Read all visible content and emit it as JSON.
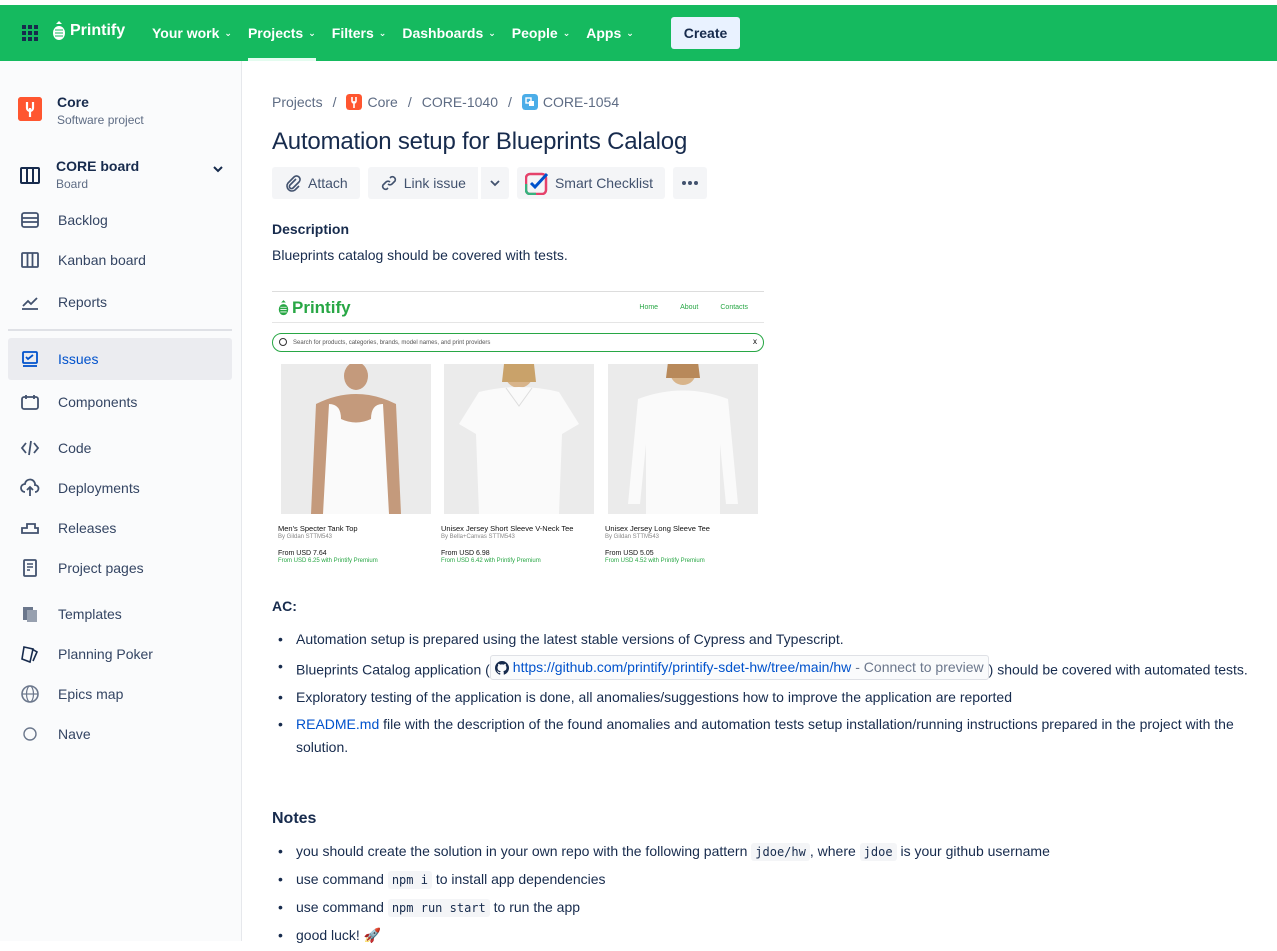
{
  "topbar": {
    "brand": "Printify",
    "nav": [
      {
        "label": "Your work",
        "active": false
      },
      {
        "label": "Projects",
        "active": true
      },
      {
        "label": "Filters",
        "active": false
      },
      {
        "label": "Dashboards",
        "active": false
      },
      {
        "label": "People",
        "active": false
      },
      {
        "label": "Apps",
        "active": false
      }
    ],
    "create_label": "Create",
    "color": "#15ba5f"
  },
  "sidebar": {
    "project_name": "Core",
    "project_type": "Software project",
    "board_name": "CORE board",
    "board_sub": "Board",
    "items": [
      {
        "label": "Backlog",
        "icon": "backlog-icon"
      },
      {
        "label": "Kanban board",
        "icon": "kanban-icon"
      },
      {
        "label": "Reports",
        "icon": "reports-icon"
      },
      {
        "label": "Issues",
        "icon": "issues-icon",
        "active": true
      },
      {
        "label": "Components",
        "icon": "components-icon"
      },
      {
        "label": "Code",
        "icon": "code-icon"
      },
      {
        "label": "Deployments",
        "icon": "deployments-icon"
      },
      {
        "label": "Releases",
        "icon": "releases-icon"
      },
      {
        "label": "Project pages",
        "icon": "pages-icon"
      },
      {
        "label": "Templates",
        "icon": "templates-icon"
      },
      {
        "label": "Planning Poker",
        "icon": "poker-icon"
      },
      {
        "label": "Epics map",
        "icon": "globe-icon"
      },
      {
        "label": "Nave",
        "icon": "circle-icon"
      }
    ]
  },
  "breadcrumb": {
    "projects": "Projects",
    "project": "Core",
    "parent": "CORE-1040",
    "issue": "CORE-1054"
  },
  "issue": {
    "title": "Automation setup for Blueprints Calalog",
    "actions": {
      "attach": "Attach",
      "link_issue": "Link issue",
      "smart_checklist": "Smart Checklist"
    },
    "description_heading": "Description",
    "description": "Blueprints catalog should be covered with tests.",
    "ac_heading": "AC:",
    "ac": {
      "item1": "Automation setup is prepared using the latest stable versions of Cypress and Typescript.",
      "item2_pre": "Blueprints Catalog application (",
      "item2_link": "https://github.com/printify/printify-sdet-hw/tree/main/hw",
      "item2_connect": " - Connect to preview",
      "item2_post": ") should be covered with automated tests.",
      "item3": "Exploratory testing of the application is done, all anomalies/suggestions how to improve the application are reported",
      "item4_link": "README.md",
      "item4_post": " file with the description of the found anomalies and automation tests setup installation/running instructions prepared in the project with the solution."
    },
    "notes_heading": "Notes",
    "notes": {
      "n1_a": "you should create the solution in your own repo with the following pattern ",
      "n1_code1": "jdoe/hw",
      "n1_b": ", where ",
      "n1_code2": "jdoe",
      "n1_c": " is your github username",
      "n2_a": "use command ",
      "n2_code": "npm i",
      "n2_b": " to install app dependencies",
      "n3_a": "use command ",
      "n3_code": "npm run start",
      "n3_b": " to run the app",
      "n4": "good luck! 🚀"
    }
  },
  "screenshot": {
    "brand": "Printify",
    "links": [
      "Home",
      "About",
      "Contacts"
    ],
    "search_placeholder": "Search for products, categories, brands, model names, and print providers",
    "search_clear": "x",
    "products": [
      {
        "name": "Men's Specter Tank Top",
        "brand": "By Gildan STTM543",
        "price": "From USD 7.64",
        "premium": "From USD 6.25 with Printify Premium"
      },
      {
        "name": "Unisex Jersey Short Sleeve V-Neck Tee",
        "brand": "By Bella+Canvas STTM543",
        "price": "From USD 6.98",
        "premium": "From USD 6.42 with Printify Premium"
      },
      {
        "name": "Unisex Jersey Long Sleeve Tee",
        "brand": "By Gildan STTM543",
        "price": "From USD 5.05",
        "premium": "From USD 4.52 with Printify Premium"
      }
    ]
  }
}
